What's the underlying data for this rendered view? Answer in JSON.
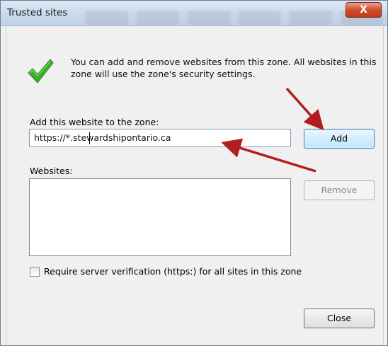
{
  "window": {
    "title": "Trusted sites",
    "close_glyph": "X"
  },
  "info": {
    "text": "You can add and remove websites from this zone. All websites in this zone will use the zone's security settings.",
    "icon": "green-checkmark-icon"
  },
  "add_site": {
    "label": "Add this website to the zone:",
    "value": "https://*.stewardshipontario.ca",
    "button_label": "Add"
  },
  "websites": {
    "label": "Websites:",
    "items": [],
    "remove_label": "Remove"
  },
  "verification": {
    "label": "Require server verification (https:) for all sites in this zone",
    "checked": false
  },
  "footer": {
    "close_label": "Close"
  },
  "annotations": {
    "arrow_color": "#b41d1d",
    "arrows": [
      "red-arrow-to-add-button",
      "red-arrow-to-url-field"
    ]
  },
  "colors": {
    "accent_button_border": "#3c7fb1",
    "check_green": "#3cae2a"
  }
}
